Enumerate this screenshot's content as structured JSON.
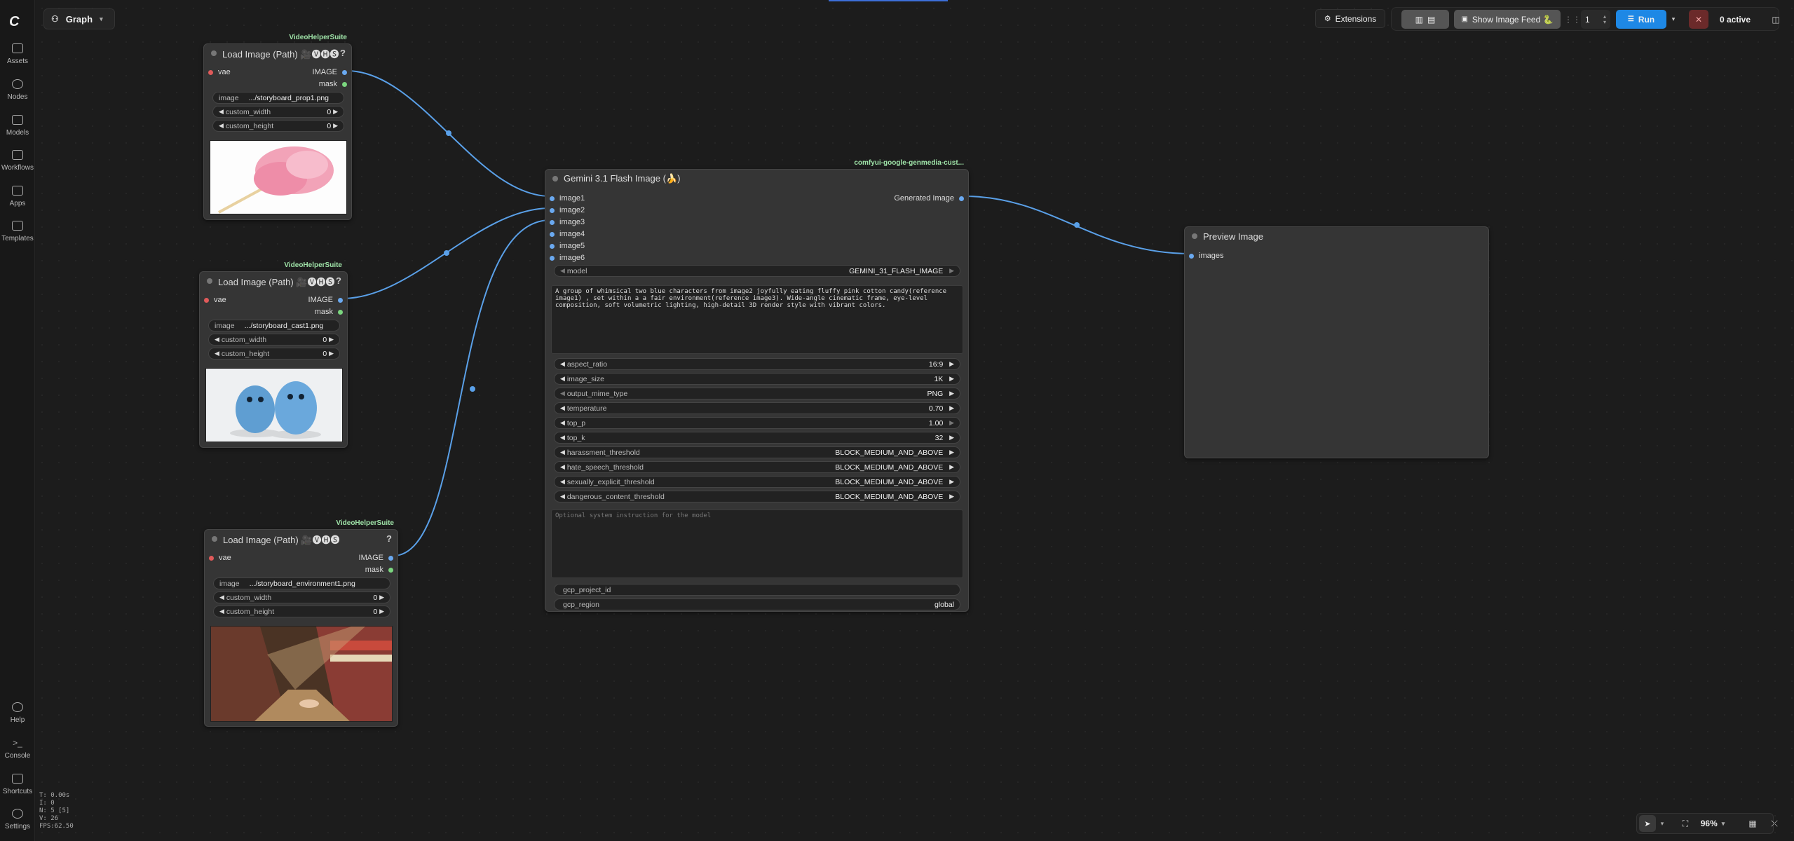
{
  "app": {
    "graph_tab_label": "Graph"
  },
  "sidebar": {
    "items": [
      {
        "label": "Assets",
        "icon": "assets-icon"
      },
      {
        "label": "Nodes",
        "icon": "nodes-icon"
      },
      {
        "label": "Models",
        "icon": "models-icon"
      },
      {
        "label": "Workflows",
        "icon": "workflows-icon"
      },
      {
        "label": "Apps",
        "icon": "apps-icon"
      },
      {
        "label": "Templates",
        "icon": "templates-icon"
      }
    ],
    "bottom_items": [
      {
        "label": "Help"
      },
      {
        "label": "Console"
      },
      {
        "label": "Shortcuts"
      },
      {
        "label": "Settings"
      }
    ],
    "stats": [
      "T: 0.00s",
      "I: 0",
      "N: 5 [5]",
      "V: 26",
      "FPS:62.50"
    ]
  },
  "topbar": {
    "extensions_label": "Extensions",
    "show_image_feed_label": "Show Image Feed 🐍",
    "batch_count": "1",
    "run_label": "Run",
    "active_label": "0 active"
  },
  "nodes": {
    "load1": {
      "badge": "VideoHelperSuite",
      "title": "Load Image (Path) 🎥🅥🅗🅢",
      "input_vae": "vae",
      "output_image": "IMAGE",
      "output_mask": "mask",
      "image_label": "image",
      "image_value": ".../storyboard_prop1.png",
      "width_label": "custom_width",
      "width_value": "0",
      "height_label": "custom_height",
      "height_value": "0"
    },
    "load2": {
      "badge": "VideoHelperSuite",
      "title": "Load Image (Path) 🎥🅥🅗🅢",
      "input_vae": "vae",
      "output_image": "IMAGE",
      "output_mask": "mask",
      "image_label": "image",
      "image_value": ".../storyboard_cast1.png",
      "width_label": "custom_width",
      "width_value": "0",
      "height_label": "custom_height",
      "height_value": "0"
    },
    "load3": {
      "badge": "VideoHelperSuite",
      "title": "Load Image (Path) 🎥🅥🅗🅢",
      "input_vae": "vae",
      "output_image": "IMAGE",
      "output_mask": "mask",
      "image_label": "image",
      "image_value": ".../storyboard_environment1.png",
      "width_label": "custom_width",
      "width_value": "0",
      "height_label": "custom_height",
      "height_value": "0"
    },
    "gemini": {
      "badge": "comfyui-google-genmedia-cust...",
      "title": "Gemini 3.1 Flash Image (🍌)",
      "inputs": [
        "image1",
        "image2",
        "image3",
        "image4",
        "image5",
        "image6"
      ],
      "output": "Generated Image",
      "model_label": "model",
      "model_value": "GEMINI_31_FLASH_IMAGE",
      "prompt": "A group of whimsical two blue characters from image2 joyfully eating fluffy pink cotton candy(reference image1) , set within a a fair environment(reference image3). Wide-angle cinematic frame, eye-level composition, soft volumetric lighting, high-detail 3D render style with vibrant colors.",
      "params": [
        {
          "label": "aspect_ratio",
          "value": "16:9"
        },
        {
          "label": "image_size",
          "value": "1K"
        },
        {
          "label": "output_mime_type",
          "value": "PNG"
        },
        {
          "label": "temperature",
          "value": "0.70"
        },
        {
          "label": "top_p",
          "value": "1.00"
        },
        {
          "label": "top_k",
          "value": "32"
        },
        {
          "label": "harassment_threshold",
          "value": "BLOCK_MEDIUM_AND_ABOVE"
        },
        {
          "label": "hate_speech_threshold",
          "value": "BLOCK_MEDIUM_AND_ABOVE"
        },
        {
          "label": "sexually_explicit_threshold",
          "value": "BLOCK_MEDIUM_AND_ABOVE"
        },
        {
          "label": "dangerous_content_threshold",
          "value": "BLOCK_MEDIUM_AND_ABOVE"
        }
      ],
      "system_placeholder": "Optional system instruction for the model",
      "project_label": "gcp_project_id",
      "region_label": "gcp_region",
      "region_value": "global"
    },
    "preview": {
      "title": "Preview Image",
      "input": "images"
    }
  },
  "bottom_toolbar": {
    "zoom": "96%"
  },
  "colors": {
    "wire": "#5aa0e8",
    "run_button": "#1e88e5",
    "badge_text": "#9fe3a8"
  }
}
